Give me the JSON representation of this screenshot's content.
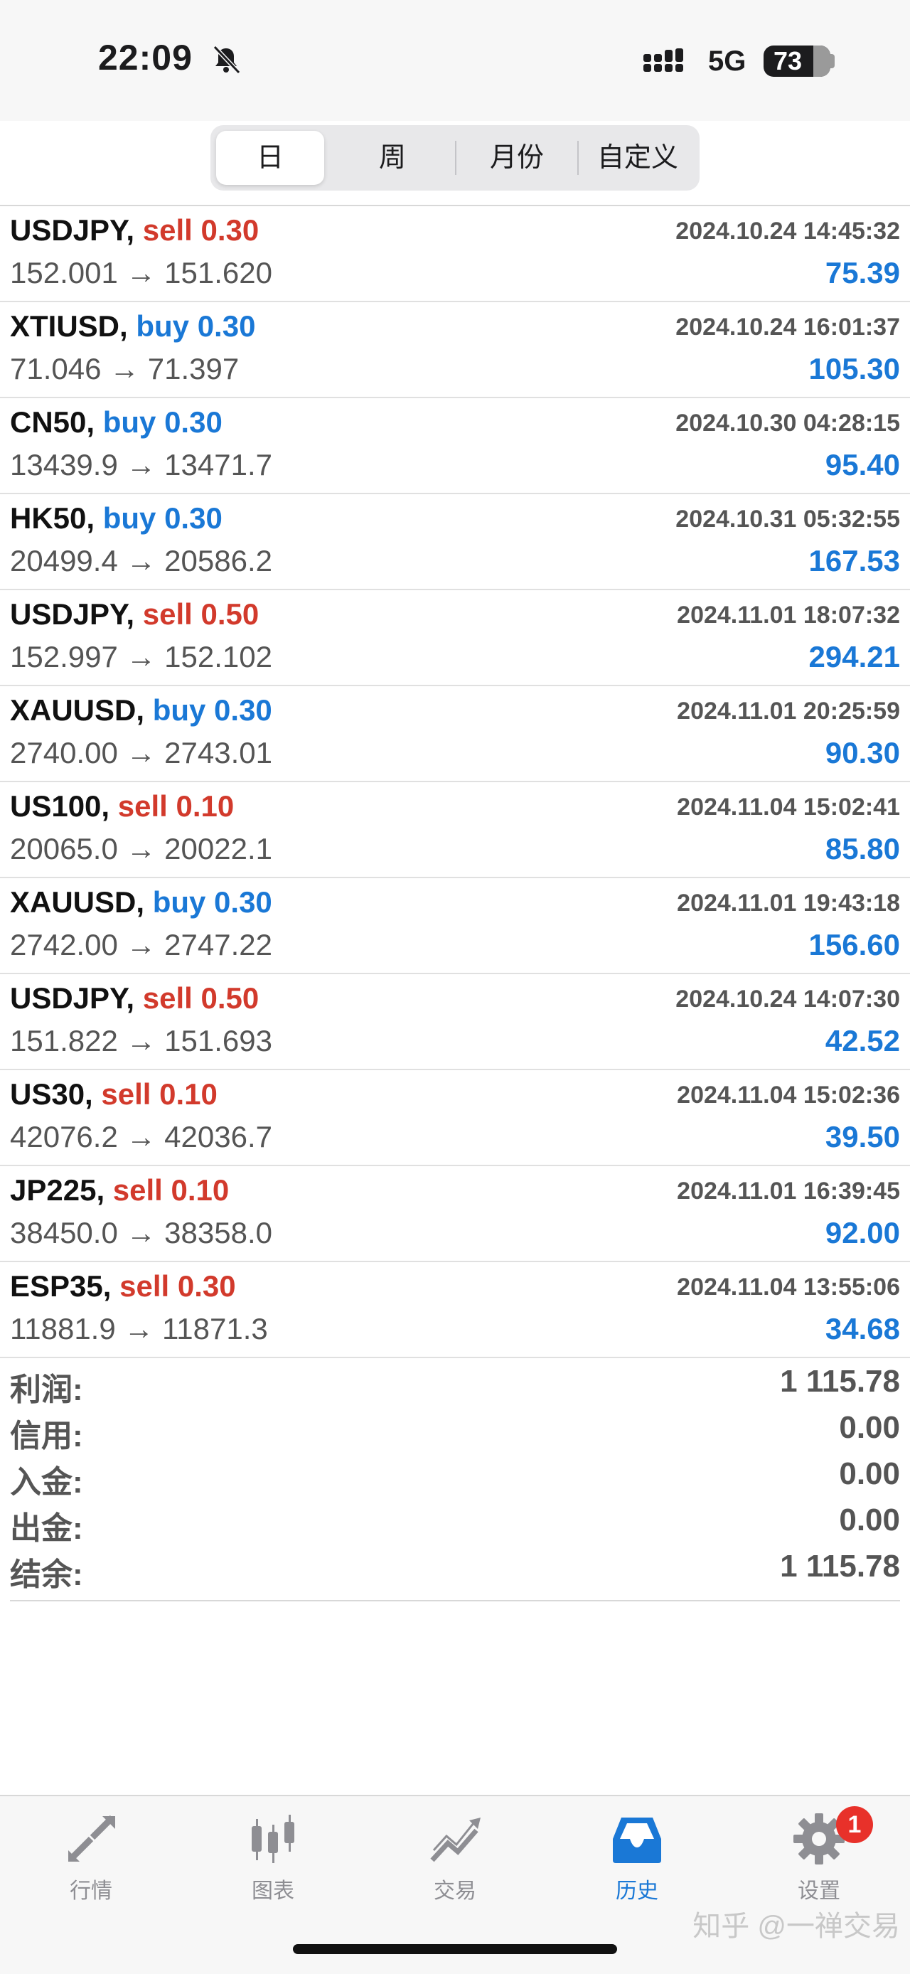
{
  "status_bar": {
    "time": "22:09",
    "network": "5G",
    "battery": "73"
  },
  "segments": [
    "日",
    "周",
    "月份",
    "自定义"
  ],
  "trades": [
    {
      "symbol": "USDJPY,",
      "side": "sell",
      "volume": "0.30",
      "datetime": "2024.10.24 14:45:32",
      "prices": "152.001 → 151.620",
      "profit": "75.39"
    },
    {
      "symbol": "XTIUSD,",
      "side": "buy",
      "volume": "0.30",
      "datetime": "2024.10.24 16:01:37",
      "prices": "71.046 → 71.397",
      "profit": "105.30"
    },
    {
      "symbol": "CN50,",
      "side": "buy",
      "volume": "0.30",
      "datetime": "2024.10.30 04:28:15",
      "prices": "13439.9 → 13471.7",
      "profit": "95.40"
    },
    {
      "symbol": "HK50,",
      "side": "buy",
      "volume": "0.30",
      "datetime": "2024.10.31 05:32:55",
      "prices": "20499.4 → 20586.2",
      "profit": "167.53"
    },
    {
      "symbol": "USDJPY,",
      "side": "sell",
      "volume": "0.50",
      "datetime": "2024.11.01 18:07:32",
      "prices": "152.997 → 152.102",
      "profit": "294.21"
    },
    {
      "symbol": "XAUUSD,",
      "side": "buy",
      "volume": "0.30",
      "datetime": "2024.11.01 20:25:59",
      "prices": "2740.00 → 2743.01",
      "profit": "90.30"
    },
    {
      "symbol": "US100,",
      "side": "sell",
      "volume": "0.10",
      "datetime": "2024.11.04 15:02:41",
      "prices": "20065.0 → 20022.1",
      "profit": "85.80"
    },
    {
      "symbol": "XAUUSD,",
      "side": "buy",
      "volume": "0.30",
      "datetime": "2024.11.01 19:43:18",
      "prices": "2742.00 → 2747.22",
      "profit": "156.60"
    },
    {
      "symbol": "USDJPY,",
      "side": "sell",
      "volume": "0.50",
      "datetime": "2024.10.24 14:07:30",
      "prices": "151.822 → 151.693",
      "profit": "42.52"
    },
    {
      "symbol": "US30,",
      "side": "sell",
      "volume": "0.10",
      "datetime": "2024.11.04 15:02:36",
      "prices": "42076.2 → 42036.7",
      "profit": "39.50"
    },
    {
      "symbol": "JP225,",
      "side": "sell",
      "volume": "0.10",
      "datetime": "2024.11.01 16:39:45",
      "prices": "38450.0 → 38358.0",
      "profit": "92.00"
    },
    {
      "symbol": "ESP35,",
      "side": "sell",
      "volume": "0.30",
      "datetime": "2024.11.04 13:55:06",
      "prices": "11881.9 → 11871.3",
      "profit": "34.68"
    }
  ],
  "summary": [
    {
      "label": "利润:",
      "value": "1 115.78"
    },
    {
      "label": "信用:",
      "value": "0.00"
    },
    {
      "label": "入金:",
      "value": "0.00"
    },
    {
      "label": "出金:",
      "value": "0.00"
    },
    {
      "label": "结余:",
      "value": "1 115.78"
    }
  ],
  "tabs": [
    {
      "label": "行情",
      "icon": "quotes-arrows-icon"
    },
    {
      "label": "图表",
      "icon": "candlestick-chart-icon"
    },
    {
      "label": "交易",
      "icon": "trade-trend-icon"
    },
    {
      "label": "历史",
      "icon": "history-inbox-icon"
    },
    {
      "label": "设置",
      "icon": "gear-icon",
      "badge": "1"
    }
  ],
  "colors": {
    "sell": "#d23a2c",
    "buy": "#1a78d6",
    "profit": "#1a78d6",
    "active_tab": "#1a78d6",
    "inactive_tab": "#8e8e93",
    "badge": "#e8312a"
  },
  "watermark": "知乎 @一禅交易"
}
